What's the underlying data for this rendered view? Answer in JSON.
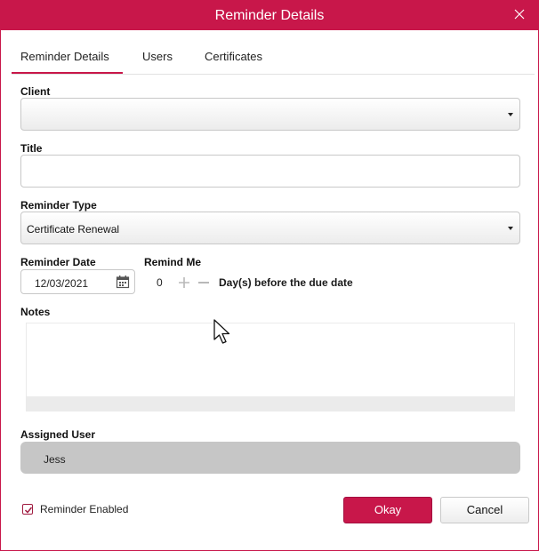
{
  "window": {
    "title": "Reminder Details",
    "accent": "#c8174a"
  },
  "tabs": [
    {
      "label": "Reminder Details",
      "active": true
    },
    {
      "label": "Users",
      "active": false
    },
    {
      "label": "Certificates",
      "active": false
    }
  ],
  "form": {
    "client": {
      "label": "Client",
      "value": ""
    },
    "title": {
      "label": "Title",
      "value": ""
    },
    "reminder_type": {
      "label": "Reminder Type",
      "value": "Certificate Renewal"
    },
    "reminder_date": {
      "label": "Reminder Date",
      "value": "12/03/2021"
    },
    "remind_me": {
      "label": "Remind Me",
      "value": "0",
      "suffix": "Day(s) before the due date"
    },
    "notes": {
      "label": "Notes",
      "value": ""
    },
    "assigned_user": {
      "label": "Assigned User",
      "value": "Jess"
    }
  },
  "footer": {
    "reminder_enabled": {
      "label": "Reminder Enabled",
      "checked": true
    },
    "okay_label": "Okay",
    "cancel_label": "Cancel"
  },
  "icons": {
    "close": "close-icon",
    "calendar": "calendar-icon",
    "plus": "plus-icon",
    "minus": "minus-icon",
    "check": "check-icon",
    "cursor": "mouse-cursor-icon"
  }
}
